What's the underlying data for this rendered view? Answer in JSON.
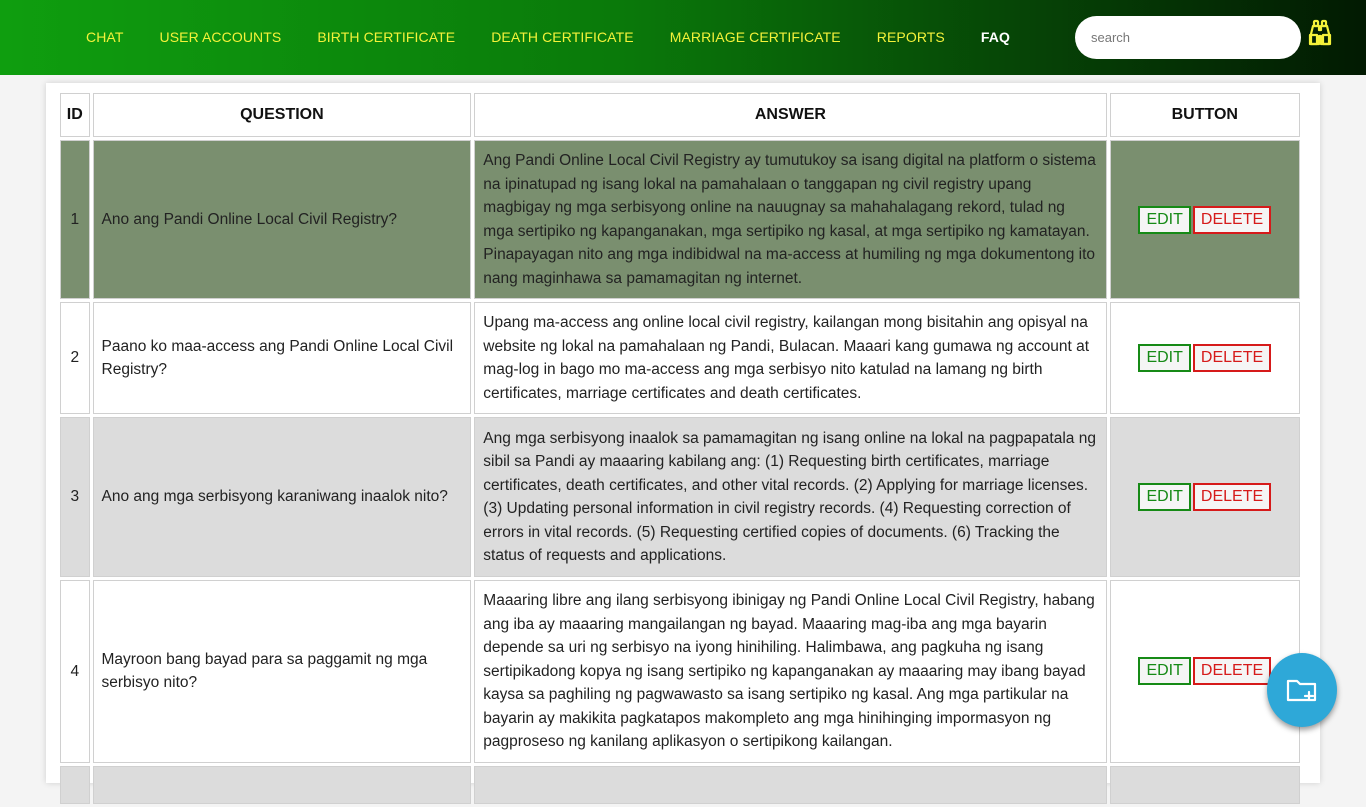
{
  "nav": {
    "items": [
      "CHAT",
      "USER ACCOUNTS",
      "BIRTH CERTIFICATE",
      "DEATH CERTIFICATE",
      "MARRIAGE CERTIFICATE",
      "REPORTS",
      "FAQ"
    ],
    "active": "FAQ"
  },
  "search": {
    "placeholder": "search",
    "value": ""
  },
  "icons": {
    "search_button": "binoculars-icon",
    "fab": "folder-add-icon"
  },
  "colors": {
    "nav_text": "#f4f23a",
    "edit": "#168a16",
    "delete": "#d61a1a",
    "row_selected": "#7a8f6f",
    "row_alt": "#dcdcdc",
    "fab": "#2ea8d8"
  },
  "table": {
    "headers": [
      "ID",
      "QUESTION",
      "ANSWER",
      "BUTTON"
    ],
    "edit_label": "EDIT",
    "delete_label": "DELETE",
    "rows": [
      {
        "id": "1",
        "question": "Ano ang Pandi Online Local Civil Registry?",
        "answer": "Ang Pandi Online Local Civil Registry ay tumutukoy sa isang digital na platform o sistema na ipinatupad ng isang lokal na pamahalaan o tanggapan ng civil registry upang magbigay ng mga serbisyong online na nauugnay sa mahahalagang rekord, tulad ng mga sertipiko ng kapanganakan, mga sertipiko ng kasal, at mga sertipiko ng kamatayan. Pinapayagan nito ang mga indibidwal na ma-access at humiling ng mga dokumentong ito nang maginhawa sa pamamagitan ng internet."
      },
      {
        "id": "2",
        "question": "Paano ko maa-access ang Pandi Online Local Civil Registry?",
        "answer": "Upang ma-access ang online local civil registry, kailangan mong bisitahin ang opisyal na website ng lokal na pamahalaan ng Pandi, Bulacan. Maaari kang gumawa ng account at mag-log in bago mo ma-access ang mga serbisyo nito katulad na lamang ng birth certificates, marriage certificates and death certificates."
      },
      {
        "id": "3",
        "question": "Ano ang mga serbisyong karaniwang inaalok nito?",
        "answer": "Ang mga serbisyong inaalok sa pamamagitan ng isang online na lokal na pagpapatala ng sibil sa Pandi ay maaaring kabilang ang: (1) Requesting birth certificates, marriage certificates, death certificates, and other vital records. (2) Applying for marriage licenses. (3) Updating personal information in civil registry records. (4) Requesting correction of errors in vital records. (5) Requesting certified copies of documents. (6) Tracking the status of requests and applications."
      },
      {
        "id": "4",
        "question": "Mayroon bang bayad para sa paggamit ng mga serbisyo nito?",
        "answer": "Maaaring libre ang ilang serbisyong ibinigay ng Pandi Online Local Civil Registry, habang ang iba ay maaaring mangailangan ng bayad. Maaaring mag-iba ang mga bayarin depende sa uri ng serbisyo na iyong hinihiling. Halimbawa, ang pagkuha ng isang sertipikadong kopya ng isang sertipiko ng kapanganakan ay maaaring may ibang bayad kaysa sa paghiling ng pagwawasto sa isang sertipiko ng kasal. Ang mga partikular na bayarin ay makikita pagkatapos makompleto ang mga hinihinging impormasyon ng pagproseso ng kanilang aplikasyon o sertipikong kailangan."
      }
    ]
  }
}
